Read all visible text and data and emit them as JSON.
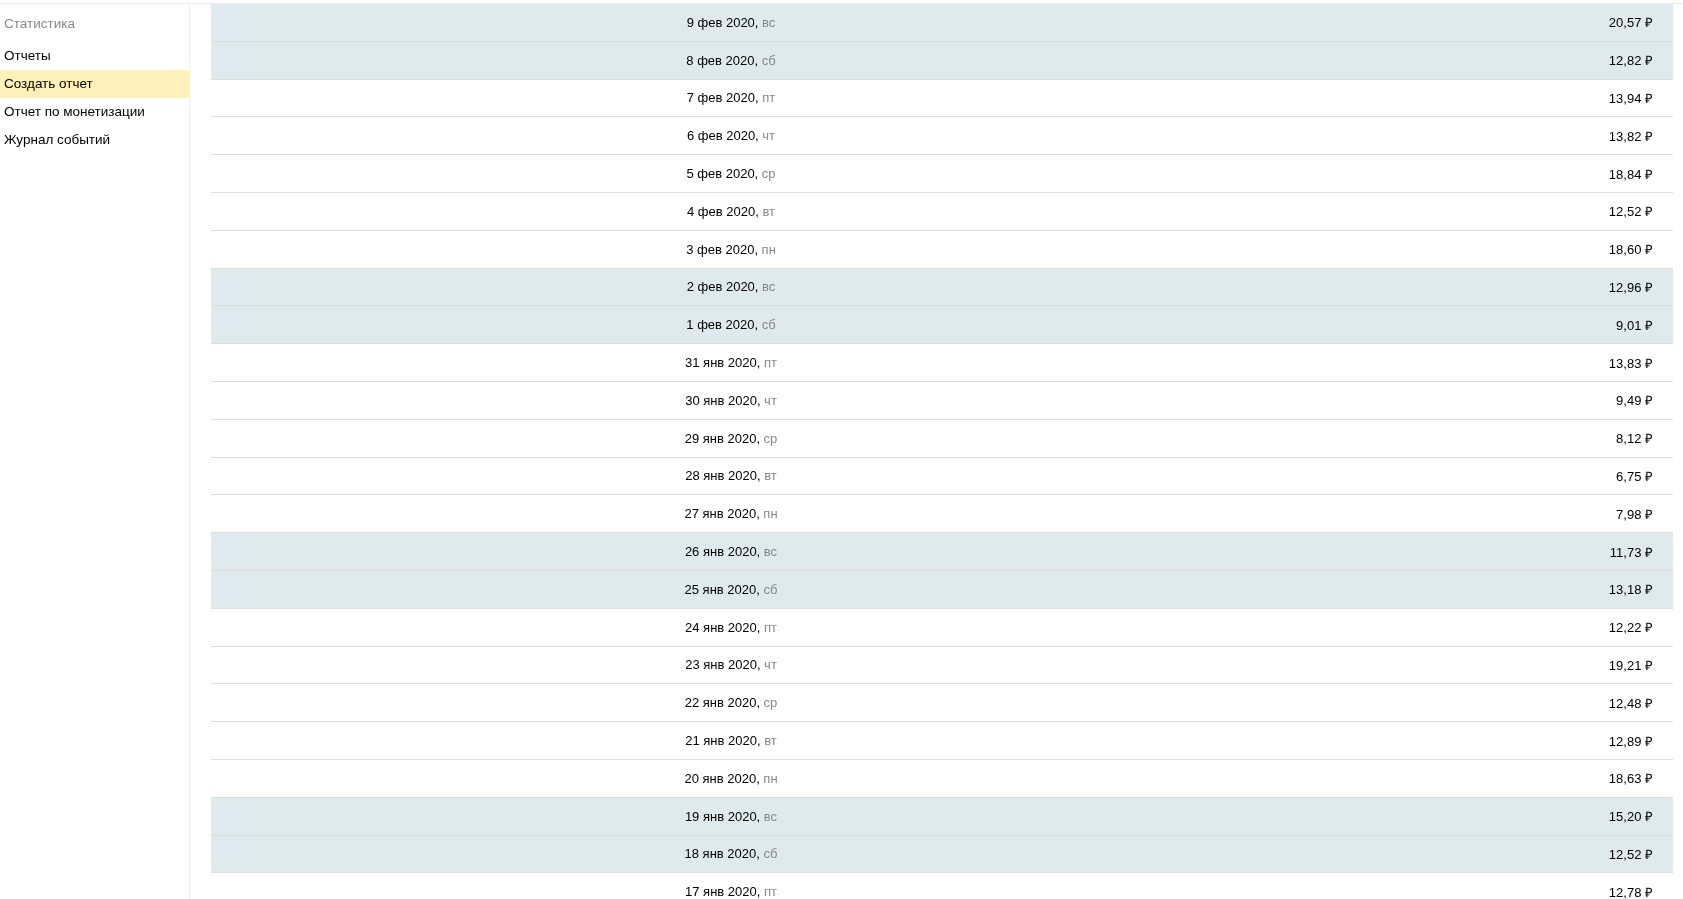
{
  "sidebar": {
    "heading": "Статистика",
    "items": [
      {
        "label": "Отчеты",
        "selected": false
      },
      {
        "label": "Создать отчет",
        "selected": true
      },
      {
        "label": "Отчет по монетизации",
        "selected": false
      },
      {
        "label": "Журнал событий",
        "selected": false
      }
    ]
  },
  "table": {
    "rows": [
      {
        "date": "9 фев 2020,",
        "weekday": "вс",
        "amount": "20,57 ₽",
        "highlighted": true
      },
      {
        "date": "8 фев 2020,",
        "weekday": "сб",
        "amount": "12,82 ₽",
        "highlighted": true
      },
      {
        "date": "7 фев 2020,",
        "weekday": "пт",
        "amount": "13,94 ₽",
        "highlighted": false
      },
      {
        "date": "6 фев 2020,",
        "weekday": "чт",
        "amount": "13,82 ₽",
        "highlighted": false
      },
      {
        "date": "5 фев 2020,",
        "weekday": "ср",
        "amount": "18,84 ₽",
        "highlighted": false
      },
      {
        "date": "4 фев 2020,",
        "weekday": "вт",
        "amount": "12,52 ₽",
        "highlighted": false
      },
      {
        "date": "3 фев 2020,",
        "weekday": "пн",
        "amount": "18,60 ₽",
        "highlighted": false
      },
      {
        "date": "2 фев 2020,",
        "weekday": "вс",
        "amount": "12,96 ₽",
        "highlighted": true
      },
      {
        "date": "1 фев 2020,",
        "weekday": "сб",
        "amount": "9,01 ₽",
        "highlighted": true
      },
      {
        "date": "31 янв 2020,",
        "weekday": "пт",
        "amount": "13,83 ₽",
        "highlighted": false
      },
      {
        "date": "30 янв 2020,",
        "weekday": "чт",
        "amount": "9,49 ₽",
        "highlighted": false
      },
      {
        "date": "29 янв 2020,",
        "weekday": "ср",
        "amount": "8,12 ₽",
        "highlighted": false
      },
      {
        "date": "28 янв 2020,",
        "weekday": "вт",
        "amount": "6,75 ₽",
        "highlighted": false
      },
      {
        "date": "27 янв 2020,",
        "weekday": "пн",
        "amount": "7,98 ₽",
        "highlighted": false
      },
      {
        "date": "26 янв 2020,",
        "weekday": "вс",
        "amount": "11,73 ₽",
        "highlighted": true
      },
      {
        "date": "25 янв 2020,",
        "weekday": "сб",
        "amount": "13,18 ₽",
        "highlighted": true
      },
      {
        "date": "24 янв 2020,",
        "weekday": "пт",
        "amount": "12,22 ₽",
        "highlighted": false
      },
      {
        "date": "23 янв 2020,",
        "weekday": "чт",
        "amount": "19,21 ₽",
        "highlighted": false
      },
      {
        "date": "22 янв 2020,",
        "weekday": "ср",
        "amount": "12,48 ₽",
        "highlighted": false
      },
      {
        "date": "21 янв 2020,",
        "weekday": "вт",
        "amount": "12,89 ₽",
        "highlighted": false
      },
      {
        "date": "20 янв 2020,",
        "weekday": "пн",
        "amount": "18,63 ₽",
        "highlighted": false
      },
      {
        "date": "19 янв 2020,",
        "weekday": "вс",
        "amount": "15,20 ₽",
        "highlighted": true
      },
      {
        "date": "18 янв 2020,",
        "weekday": "сб",
        "amount": "12,52 ₽",
        "highlighted": true
      },
      {
        "date": "17 янв 2020,",
        "weekday": "пт",
        "amount": "12,78 ₽",
        "highlighted": false
      }
    ]
  }
}
